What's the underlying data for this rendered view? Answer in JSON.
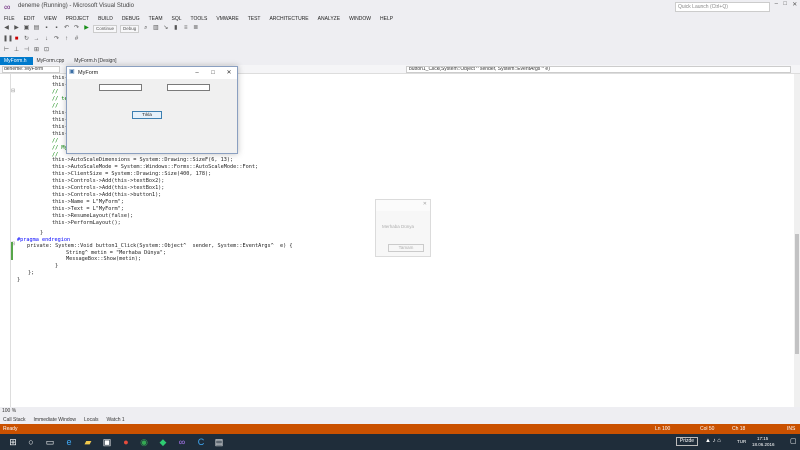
{
  "window": {
    "title": "deneme (Running) - Microsoft Visual Studio",
    "quick_launch_placeholder": "Quick Launch (Ctrl+Q)"
  },
  "menu": [
    "FILE",
    "EDIT",
    "VIEW",
    "PROJECT",
    "BUILD",
    "DEBUG",
    "TEAM",
    "SQL",
    "TOOLS",
    "VMWARE",
    "TEST",
    "ARCHITECTURE",
    "ANALYZE",
    "WINDOW",
    "HELP"
  ],
  "toolbar": {
    "continue_label": "Continue",
    "config_value": "Debug"
  },
  "tabs": [
    {
      "label": "MyForm.h",
      "active": true
    },
    {
      "label": "MyForm.cpp",
      "active": false
    },
    {
      "label": "MyForm.h [Design]",
      "active": false
    }
  ],
  "nav": {
    "left": "deneme::MyForm",
    "right": "button1_Click(System::Object ^ sender, System::EventArgs ^ e)"
  },
  "code_lines": {
    "l1": "this->",
    "l2": "this->",
    "l3": "// ",
    "l4": "// te",
    "l5": "// ",
    "l6": "this->",
    "l7": "this->",
    "l8": "this->",
    "l9": "this->",
    "l10": "// ",
    "l11": "// My",
    "l12": "// ",
    "l13": "this->AutoScaleDimensions = System::Drawing::SizeF(6, 13);",
    "l14": "this->AutoScaleMode = System::Windows::Forms::AutoScaleMode::Font;",
    "l15": "this->ClientSize = System::Drawing::Size(400, 178);",
    "l16": "this->Controls->Add(this->textBox2);",
    "l17": "this->Controls->Add(this->textBox1);",
    "l18": "this->Controls->Add(this->button1);",
    "l19": "this->Name = L\"MyForm\";",
    "l20": "this->Text = L\"MyForm\";",
    "l21": "this->ResumeLayout(false);",
    "l22": "this->PerformLayout();",
    "l23": "}",
    "l24": "#pragma endregion",
    "l25": "private: System::Void button1_Click(System::Object^  sender, System::EventArgs^  e) {",
    "l26": "String^ metin = \"Merhaba Dünya\";",
    "l27": "MessageBox::Show(metin);",
    "l28": "}",
    "l29": "};",
    "l30": "}"
  },
  "form_window": {
    "title": "MyForm",
    "button_label": "Tıkla"
  },
  "message_box": {
    "text": "Merhaba Dünya",
    "button_label": "Tamam"
  },
  "zoom": "100 %",
  "bottom_tabs": [
    "Call Stack",
    "Immediate Window",
    "Locals",
    "Watch 1"
  ],
  "status": {
    "state": "Ready",
    "line": "Ln 100",
    "col": "Col 50",
    "ch": "Ch 18",
    "ins": "INS"
  },
  "taskbar": {
    "active_app_label": "Prizde",
    "time": "17:15",
    "date": "18.06.2016",
    "lang": "TUR"
  },
  "colors": {
    "accent": "#007acc",
    "statusbar": "#ca5100",
    "taskbar": "#1f2d3a"
  }
}
